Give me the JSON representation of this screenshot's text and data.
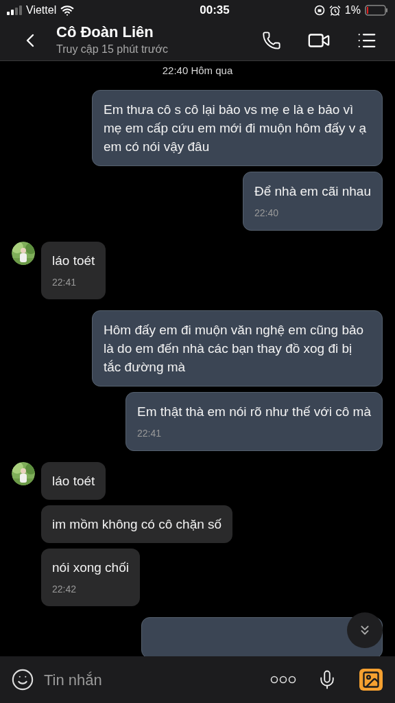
{
  "status_bar": {
    "carrier": "Viettel",
    "time": "00:35",
    "battery": "1%"
  },
  "header": {
    "name": "Cô Đoàn Liên",
    "status": "Truy cập 15 phút trước"
  },
  "date_separator": "22:40 Hôm qua",
  "messages": [
    {
      "kind": "sent",
      "text": "Em thưa cô s cô lại bảo vs mẹ e là e bảo vì mẹ em cấp cứu em mới đi muộn hôm đấy v ạ em có nói vậy đâu",
      "avatar": false
    },
    {
      "kind": "sent",
      "text": "Để nhà em cãi nhau",
      "time": "22:40",
      "avatar": false
    },
    {
      "kind": "received",
      "text": "láo toét",
      "time": "22:41",
      "avatar": true
    },
    {
      "kind": "sent",
      "text": "Hôm đấy em đi muộn văn nghệ em cũng bảo là do em đến nhà các bạn thay đồ xog đi bị tắc đường mà",
      "avatar": false
    },
    {
      "kind": "sent",
      "text": "Em thật thà em nói rõ như thế với cô mà",
      "time": "22:41",
      "avatar": false
    },
    {
      "kind": "received",
      "text": "láo toét",
      "avatar": true
    },
    {
      "kind": "received",
      "text": "im mồm không có cô chặn số",
      "avatar": false
    },
    {
      "kind": "received",
      "text": "nói xong chối",
      "time": "22:42",
      "avatar": false
    }
  ],
  "composer": {
    "placeholder": "Tin nhắn"
  }
}
